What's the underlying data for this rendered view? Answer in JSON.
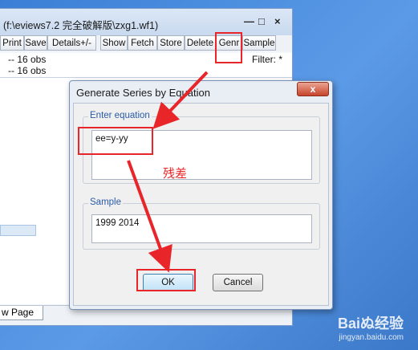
{
  "workfile": {
    "title": "(f:\\eviews7.2 完全破解版\\zxg1.wf1)",
    "controls": {
      "minimize": "—",
      "maximize": "□",
      "close": "×"
    },
    "toolbar": [
      "Print",
      "Save",
      "Details+/-",
      "Show",
      "Fetch",
      "Store",
      "Delete",
      "Genr",
      "Sample"
    ],
    "info_lines": [
      "--  16 obs",
      "--  16 obs"
    ],
    "filter_label": "Filter: *",
    "tab_label": "w Page"
  },
  "dialog": {
    "title": "Generate Series by Equation",
    "close_glyph": "x",
    "equation_group_label": "Enter equation",
    "equation_value": "ee=y-yy",
    "sample_group_label": "Sample",
    "sample_value": "1999 2014",
    "ok_label": "OK",
    "cancel_label": "Cancel"
  },
  "annotations": {
    "note": "残差",
    "color": "#e8262a"
  },
  "watermark": {
    "main": "Baiぬ经验",
    "sub": "jingyan.baidu.com"
  }
}
